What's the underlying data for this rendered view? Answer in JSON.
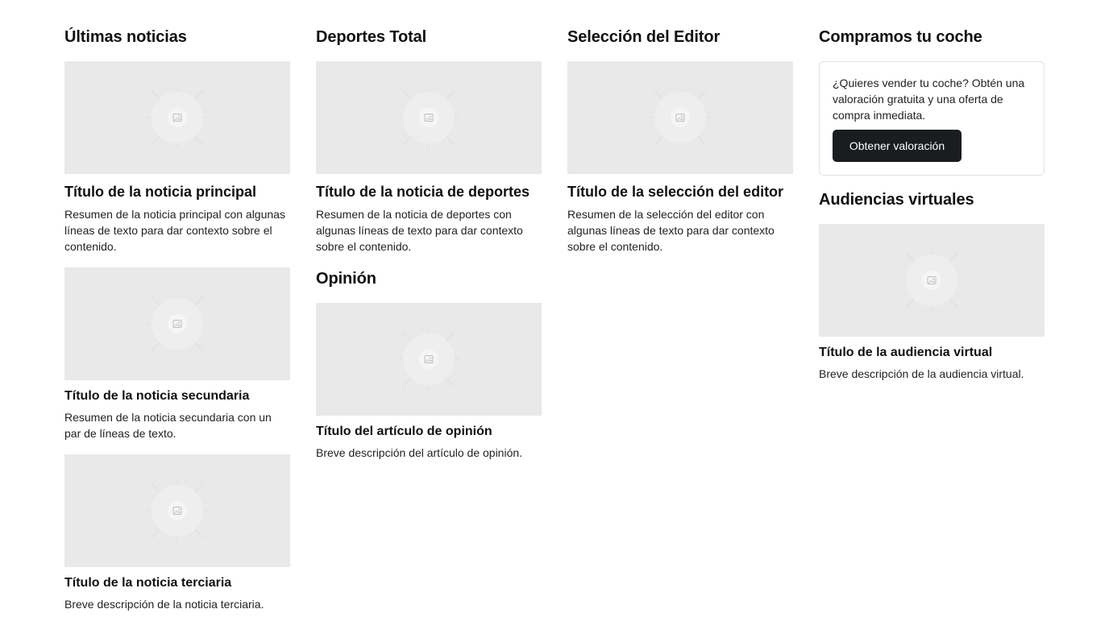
{
  "sections": {
    "latest": {
      "heading": "Últimas noticias",
      "main": {
        "title": "Título de la noticia principal",
        "summary": "Resumen de la noticia principal con algunas líneas de texto para dar contexto sobre el contenido."
      },
      "secondary": {
        "title": "Título de la noticia secundaria",
        "summary": "Resumen de la noticia secundaria con un par de líneas de texto."
      },
      "tertiary": {
        "title": "Título de la noticia terciaria",
        "summary": "Breve descripción de la noticia terciaria."
      }
    },
    "sports": {
      "heading": "Deportes Total",
      "title": "Título de la noticia de deportes",
      "summary": "Resumen de la noticia de deportes con algunas líneas de texto para dar contexto sobre el contenido."
    },
    "opinion": {
      "heading": "Opinión",
      "title": "Título del artículo de opinión",
      "summary": "Breve descripción del artículo de opinión."
    },
    "editor": {
      "heading": "Selección del Editor",
      "title": "Título de la selección del editor",
      "summary": "Resumen de la selección del editor con algunas líneas de texto para dar contexto sobre el contenido."
    },
    "buy_car": {
      "heading": "Compramos tu coche",
      "text": "¿Quieres vender tu coche? Obtén una valoración gratuita y una oferta de compra inmediata.",
      "button_label": "Obtener valoración"
    },
    "virtual": {
      "heading": "Audiencias virtuales",
      "title": "Título de la audiencia virtual",
      "summary": "Breve descripción de la audiencia virtual."
    }
  },
  "icons": {
    "thumbnail": "image-placeholder-icon"
  },
  "colors": {
    "placeholder_bg": "#e9e9e9",
    "button_bg": "#1b1c1e",
    "button_text": "#ffffff",
    "card_border": "#e3e3e3"
  }
}
